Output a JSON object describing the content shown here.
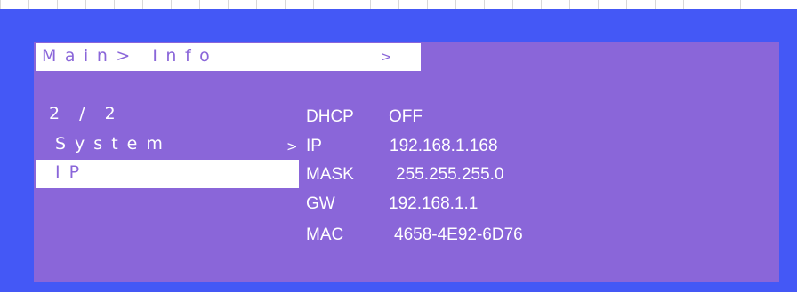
{
  "header": {
    "title": "Main> Info",
    "arrow": ">"
  },
  "menu": {
    "page_indicator": "2 / 2",
    "items": [
      {
        "label": "System",
        "arrow": ">"
      },
      {
        "label": "IP",
        "arrow": ">",
        "selected": true
      }
    ]
  },
  "info": {
    "dhcp": {
      "label": "DHCP",
      "value": "OFF"
    },
    "ip": {
      "label": "IP",
      "value": "192.168.1.168"
    },
    "mask": {
      "label": "MASK",
      "value": "255.255.255.0"
    },
    "gw": {
      "label": "GW",
      "value": "192.168.1.1"
    },
    "mac": {
      "label": "MAC",
      "value": "4658-4E92-6D76"
    }
  },
  "colors": {
    "outer_frame": "#4458f6",
    "panel": "#8a66d9",
    "highlight": "#ffffff",
    "text": "#ffffff"
  }
}
